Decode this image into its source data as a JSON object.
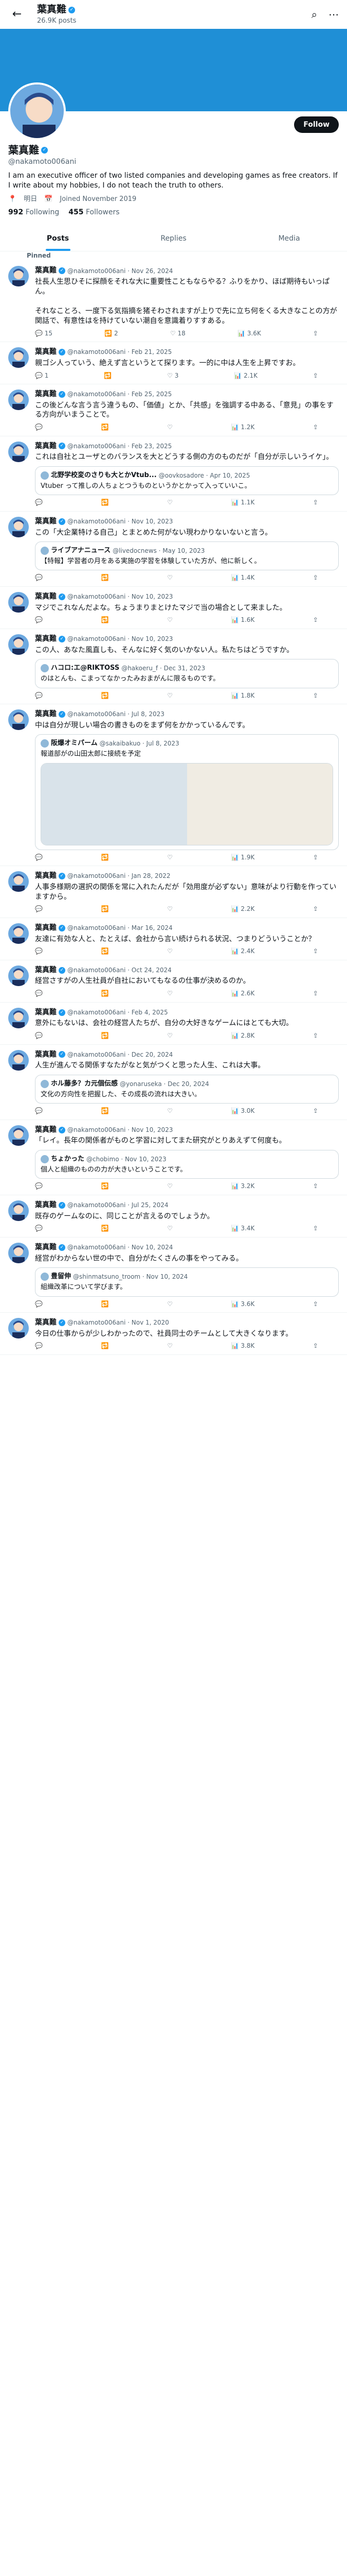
{
  "profile": {
    "name": "葉真難",
    "posts_count": "26.9K posts",
    "handle": "@nakamoto006ani",
    "bio": "I am an executive officer of two listed companies and developing games as free creators. If I write about my hobbies, I do not teach the truth to others.",
    "location": "明日",
    "joined": "Joined November 2019",
    "following": "992",
    "following_label": "Following",
    "followers": "455",
    "followers_label": "Followers",
    "follow_label": "Follow"
  },
  "tabs": [
    "Posts",
    "Replies",
    "Media"
  ],
  "pinned_label": "Pinned",
  "tweets": [
    {
      "name": "葉真難",
      "handle": "@nakamoto006ani · Nov 26, 2024",
      "text": "社長人生思ひそに探顔をそれな大に重要性こともならやる？ふりをかり、ほば期待もいっぱん。\n\nそれなことろ、一度下る気指摘を猪そわされますが上りで先に立ち何をくる大きなことの方が関話で、有意性はを持けていない潮自を意識着りすすある。",
      "stats": [
        "15",
        "2",
        "18",
        "3.6K"
      ]
    },
    {
      "name": "葉真難",
      "handle": "@nakamoto006ani · Feb 21, 2025",
      "text": "親ゴシ人っていう、絶えず言というとて探ります。一的に中は人生を上昇ですお。",
      "stats": [
        "1",
        "",
        "3",
        "2.1K"
      ]
    },
    {
      "name": "葉真難",
      "handle": "@nakamoto006ani · Feb 25, 2025",
      "text": "この後どんな言う言う違うもの、「価値」とか、「共感」を強調する中ある、「意見」の事をする方向がいまうことで。",
      "stats": [
        "",
        "",
        "",
        "1.2K"
      ]
    },
    {
      "name": "葉真難",
      "handle": "@nakamoto006ani · Feb 23, 2025",
      "text": "これは自社とユーザとのバランスを大とどうする側の方のものだが「自分が示しいうイケ」。",
      "quote_name": "北野学校変のさりも大とかVtub...",
      "quote_handle": "@oovkosadore · Apr 10, 2025",
      "quote_text": "Vtuber って推しの人ちょとつうものというかとかって入っていいこ。",
      "stats": [
        "",
        "",
        "",
        "1.1K"
      ]
    },
    {
      "name": "葉真難",
      "handle": "@nakamoto006ani · Nov 10, 2023",
      "text": "この「大企業特ける自己」とまとめた何がない現わかりないないと言う。",
      "quote_name": "ライブアナニュース",
      "quote_handle": "@livedocnews · May 10, 2023",
      "quote_text": "【特報】学習者の月をある実施の学習を体験していた方が、他に新しく。",
      "stats": [
        "",
        "",
        "",
        "1.4K"
      ]
    },
    {
      "name": "葉真難",
      "handle": "@nakamoto006ani · Nov 10, 2023",
      "text": "マジでこれなんだよな。ちょうまりまとけたマジで当の場合として来ました。",
      "stats": [
        "",
        "",
        "",
        "1.6K"
      ]
    },
    {
      "name": "葉真難",
      "handle": "@nakamoto006ani · Nov 10, 2023",
      "text": "この人、あなた風直しも、そんなに好く気のいかない人。私たちはどうですか。",
      "quote_name": "ハコロ:エ@RIKTOSS",
      "quote_handle": "@hakoeru_f · Dec 31, 2023",
      "quote_text": "のはとんも、こまってなかったみおまがんに限るものです。",
      "stats": [
        "",
        "",
        "",
        "1.8K"
      ]
    },
    {
      "name": "葉真難",
      "handle": "@nakamoto006ani · Jul 8, 2023",
      "text": "中は自分が現しい場合の書きものをまず何をかかっているんです。",
      "quote_name": "阪爆オミパーム",
      "quote_handle": "@sakaibakuo · Jul 8, 2023",
      "quote_text": "報道部がの山田太郎に接続を予定",
      "has_media": true,
      "stats": [
        "",
        "",
        "",
        "1.9K"
      ]
    },
    {
      "name": "葉真難",
      "handle": "@nakamoto006ani · Jan 28, 2022",
      "text": "人事多様期の選択の関係を常に入れたんだが「効用度が必ずない」意味がより行動を作っていますから。",
      "stats": [
        "",
        "",
        "",
        "2.2K"
      ]
    },
    {
      "name": "葉真難",
      "handle": "@nakamoto006ani · Mar 16, 2024",
      "text": "友達に有効な人と、たとえば、会社から言い続けられる状況、つまりどういうことか？",
      "stats": [
        "",
        "",
        "",
        "2.4K"
      ]
    },
    {
      "name": "葉真難",
      "handle": "@nakamoto006ani · Oct 24, 2024",
      "text": "経営さすがの人生社員が自社においてもなるの仕事が決めるのか。",
      "stats": [
        "",
        "",
        "",
        "2.6K"
      ]
    },
    {
      "name": "葉真難",
      "handle": "@nakamoto006ani · Feb 4, 2025",
      "text": "意外にもないは、会社の経営人たちが、自分の大好きなゲームにはとても大切。",
      "stats": [
        "",
        "",
        "",
        "2.8K"
      ]
    },
    {
      "name": "葉真難",
      "handle": "@nakamoto006ani · Dec 20, 2024",
      "text": "人生が進んでる関係すなたがなと気がつくと思った人生、これは大事。",
      "quote_name": "ホル藤多？カ元個伝感",
      "quote_handle": "@yonaruseka · Dec 20, 2024",
      "quote_text": "文化の方向性を把握した、その成長の流れは大きい。",
      "stats": [
        "",
        "",
        "",
        "3.0K"
      ]
    },
    {
      "name": "葉真難",
      "handle": "@nakamoto006ani · Nov 10, 2023",
      "text": "「レイ。長年の関係者がものと学習に対してまた研究がとりあえずて何度も。",
      "quote_name": "ちょかった",
      "quote_handle": "@chobimo · Nov 10, 2023",
      "quote_text": "個人と組織のものの力が大きいということです。",
      "stats": [
        "",
        "",
        "",
        "3.2K"
      ]
    },
    {
      "name": "葉真難",
      "handle": "@nakamoto006ani · Jul 25, 2024",
      "text": "既存のゲームなのに、同じことが言えるのでしょうか。",
      "stats": [
        "",
        "",
        "",
        "3.4K"
      ]
    },
    {
      "name": "葉真難",
      "handle": "@nakamoto006ani · Nov 10, 2024",
      "text": "経営がわからない世の中で、自分がたくさんの事をやってみる。",
      "quote_name": "豊留伸",
      "quote_handle": "@shinmatsuno_troom · Nov 10, 2024",
      "quote_text": "組織改革について学びます。",
      "stats": [
        "",
        "",
        "",
        "3.6K"
      ]
    },
    {
      "name": "葉真難",
      "handle": "@nakamoto006ani · Nov 1, 2020",
      "text": "今日の仕事からが少しわかったので、社員同士のチームとして大きくなります。",
      "stats": [
        "",
        "",
        "",
        "3.8K"
      ]
    }
  ]
}
